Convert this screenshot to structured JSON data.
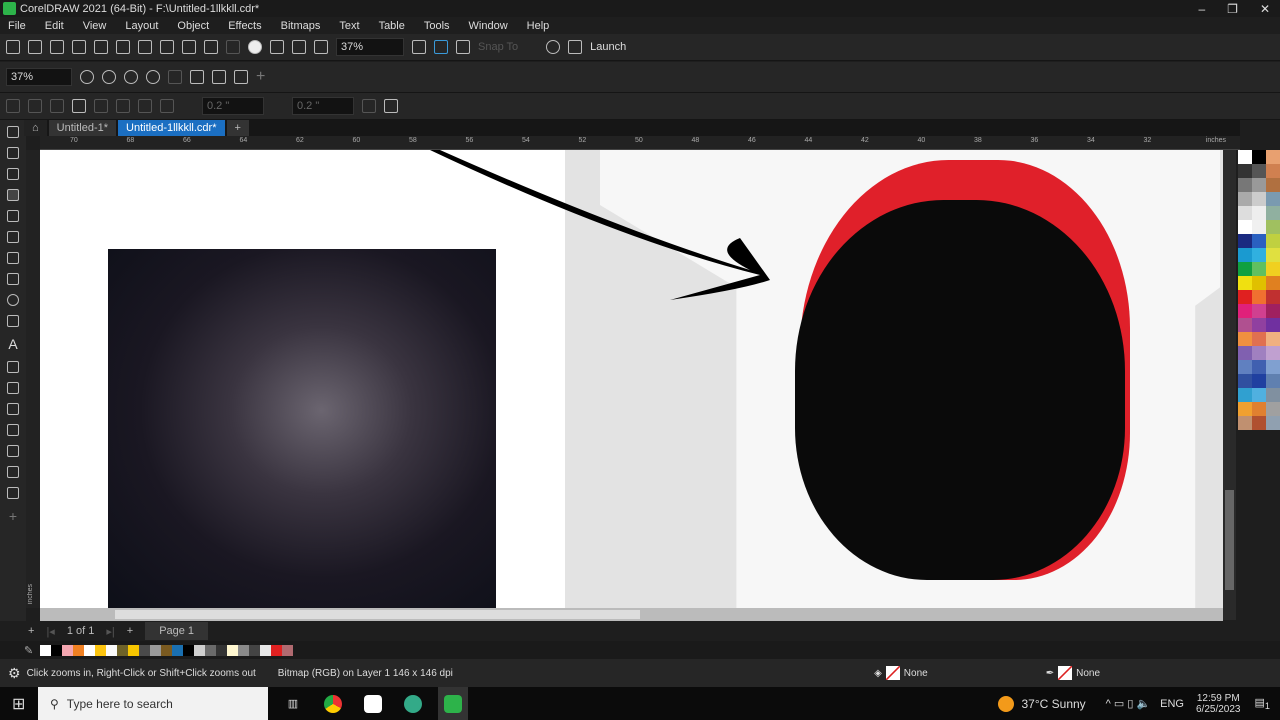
{
  "window": {
    "title": "CorelDRAW 2021 (64-Bit) - F:\\Untitled-1llkkll.cdr*"
  },
  "menu": [
    "File",
    "Edit",
    "View",
    "Layout",
    "Object",
    "Effects",
    "Bitmaps",
    "Text",
    "Table",
    "Tools",
    "Window",
    "Help"
  ],
  "toolbar": {
    "zoom": "37%",
    "snap_to": "Snap To",
    "launch": "Launch"
  },
  "zoombar": {
    "zoom": "37%"
  },
  "propbar": {
    "width1": "0.2 \"",
    "width2": "0.2 \""
  },
  "tabs": [
    {
      "label": "Untitled-1*",
      "active": false
    },
    {
      "label": "Untitled-1llkkll.cdr*",
      "active": true
    }
  ],
  "ruler": {
    "ticks": [
      "70",
      "68",
      "66",
      "64",
      "62",
      "60",
      "58",
      "56",
      "54",
      "52",
      "50",
      "48",
      "46",
      "44",
      "42",
      "40",
      "38",
      "36",
      "34",
      "32"
    ],
    "unit": "inches"
  },
  "vruler_unit": "inches",
  "pagebar": {
    "count": "1 of 1",
    "page": "Page 1"
  },
  "doc_palette": [
    "#ffffff",
    "#000000",
    "#f4a6b0",
    "#f08022",
    "#ffffff",
    "#fcc40f",
    "#fafafa",
    "#6e6228",
    "#f7c600",
    "#4a4a4a",
    "#9a9a9a",
    "#7a5a20",
    "#1a6fb0",
    "#000000",
    "#cfcfcf",
    "#6a6a6a",
    "#333333",
    "#fff7d0",
    "#8a8a8a",
    "#444444",
    "#e6e6e6",
    "#e02020",
    "#b06a70"
  ],
  "color_palette": [
    "#ffffff",
    "#000000",
    "#e8a070",
    "#333333",
    "#555555",
    "#d08050",
    "#777777",
    "#999999",
    "#b07040",
    "#aaaaaa",
    "#cccccc",
    "#7a9ab0",
    "#dddddd",
    "#eeeeee",
    "#90b0a0",
    "#ffffff",
    "#f0f0f0",
    "#a0c060",
    "#1a2a80",
    "#2a60c0",
    "#c0d040",
    "#1a9ad0",
    "#30b0e0",
    "#e0e040",
    "#10a040",
    "#60c060",
    "#f0d020",
    "#f0e010",
    "#e0c000",
    "#e08020",
    "#e02020",
    "#f07030",
    "#c03030",
    "#e0207a",
    "#d04090",
    "#a02060",
    "#b05090",
    "#9040a0",
    "#7030a0",
    "#f09040",
    "#e07050",
    "#f0b080",
    "#8060b0",
    "#a080c0",
    "#c0a0d0",
    "#6080c0",
    "#4060b0",
    "#80a0d0",
    "#3050a0",
    "#2040a0",
    "#6080b0",
    "#30a0d0",
    "#50b0e0",
    "#8090a0",
    "#f0a030",
    "#e08030",
    "#a0a0a0",
    "#c09070",
    "#b05030",
    "#90a0b0"
  ],
  "status": {
    "hint": "Click zooms in, Right-Click or Shift+Click zooms out",
    "object": "Bitmap (RGB) on Layer 1 146 x 146 dpi",
    "fill": "None",
    "outline": "None"
  },
  "taskbar": {
    "search_placeholder": "Type here to search",
    "weather": "37°C  Sunny",
    "lang": "ENG",
    "time": "12:59 PM",
    "date": "6/25/2023",
    "notifications": "1"
  }
}
